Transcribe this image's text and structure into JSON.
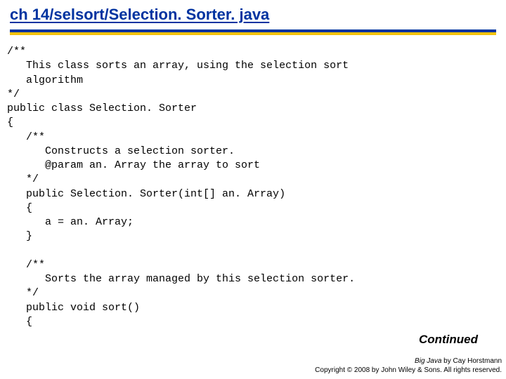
{
  "title": "ch 14/selsort/Selection. Sorter. java",
  "code": "/**\n   This class sorts an array, using the selection sort\n   algorithm\n*/\npublic class Selection. Sorter\n{\n   /**\n      Constructs a selection sorter.\n      @param an. Array the array to sort\n   */\n   public Selection. Sorter(int[] an. Array)\n   {\n      a = an. Array;\n   }\n\n   /**\n      Sorts the array managed by this selection sorter.\n   */\n   public void sort()\n   {",
  "continued": "Continued",
  "footer": {
    "book": "Big Java",
    "by": " by ",
    "author": "Cay Horstmann",
    "copyright": "Copyright © 2008 by John Wiley & Sons. All rights reserved."
  }
}
